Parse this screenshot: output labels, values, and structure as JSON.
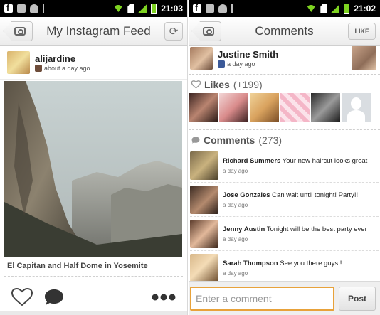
{
  "left_screen": {
    "status_bar": {
      "time": "21:03"
    },
    "title_bar": {
      "title": "My Instagram Feed"
    },
    "post": {
      "username": "alijardine",
      "timestamp": "about a day ago",
      "caption": "El Capitan and Half Dome in Yosemite"
    }
  },
  "right_screen": {
    "status_bar": {
      "time": "21:02"
    },
    "title_bar": {
      "title": "Comments",
      "like_label": "LIKE"
    },
    "author": {
      "name": "Justine Smith",
      "timestamp": "a day ago"
    },
    "likes": {
      "label": "Likes",
      "count": "(+199)"
    },
    "comments_section": {
      "label": "Comments",
      "count": "(273)"
    },
    "comments": [
      {
        "author": "Richard Summers",
        "text": "Your new haircut looks great",
        "time": "a day ago"
      },
      {
        "author": "Jose Gonzales",
        "text": "Can wait until tonight! Party!!",
        "time": "a day ago"
      },
      {
        "author": "Jenny Austin",
        "text": "Tonight will be the best party ever",
        "time": "a day ago"
      },
      {
        "author": "Sarah Thompson",
        "text": "See you there guys!!",
        "time": "a day ago"
      }
    ],
    "compose": {
      "placeholder": "Enter a comment",
      "post_label": "Post"
    }
  },
  "colors": {
    "accent_orange": "#e8a23a",
    "facebook_blue": "#3b5998",
    "status_green": "#7ed321"
  }
}
